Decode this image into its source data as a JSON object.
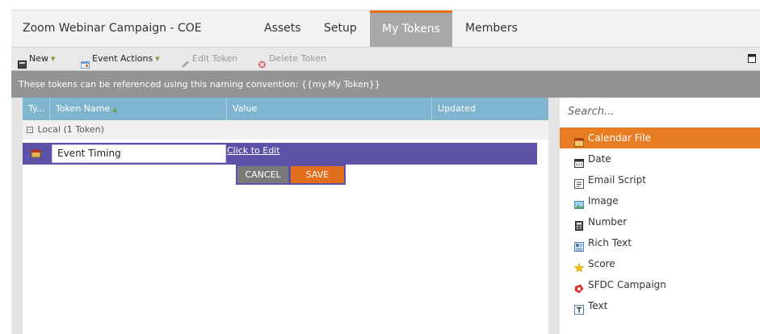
{
  "tabs": [
    {
      "label": "Zoom Webinar Campaign - COE Template"
    },
    {
      "label": "Assets"
    },
    {
      "label": "Setup"
    },
    {
      "label": "My Tokens"
    },
    {
      "label": "Members"
    }
  ],
  "active_tab": "My Tokens",
  "toolbar": {
    "new_label": "New",
    "event_actions_label": "Event Actions",
    "edit_token_label": "Edit Token",
    "delete_token_label": "Delete Token"
  },
  "info": "These tokens can be referenced using this naming convention: {{my.My Token}}",
  "grid": {
    "columns": [
      "Ty...",
      "Token Name",
      "Value",
      "Updated"
    ],
    "group_label": "Local (1 Token)",
    "editing_row": {
      "name_value": "Event Timing",
      "value_link": "Click to Edit",
      "cancel_label": "CANCEL",
      "save_label": "SAVE"
    }
  },
  "token_panel": {
    "search_placeholder": "Search...",
    "items": [
      {
        "label": "Calendar File",
        "icon": "calendar-file-icon"
      },
      {
        "label": "Date",
        "icon": "date-icon"
      },
      {
        "label": "Email Script",
        "icon": "email-script-icon"
      },
      {
        "label": "Image",
        "icon": "image-icon"
      },
      {
        "label": "Number",
        "icon": "number-icon"
      },
      {
        "label": "Rich Text",
        "icon": "rich-text-icon"
      },
      {
        "label": "Score",
        "icon": "score-star-icon"
      },
      {
        "label": "SFDC Campaign",
        "icon": "sfdc-campaign-icon"
      },
      {
        "label": "Text",
        "icon": "text-icon"
      }
    ],
    "selected": "Calendar File"
  },
  "colors": {
    "accent_orange": "#e36f1e",
    "edit_row_purple": "#5c52a8",
    "grid_header_blue": "#7fb5ce"
  }
}
